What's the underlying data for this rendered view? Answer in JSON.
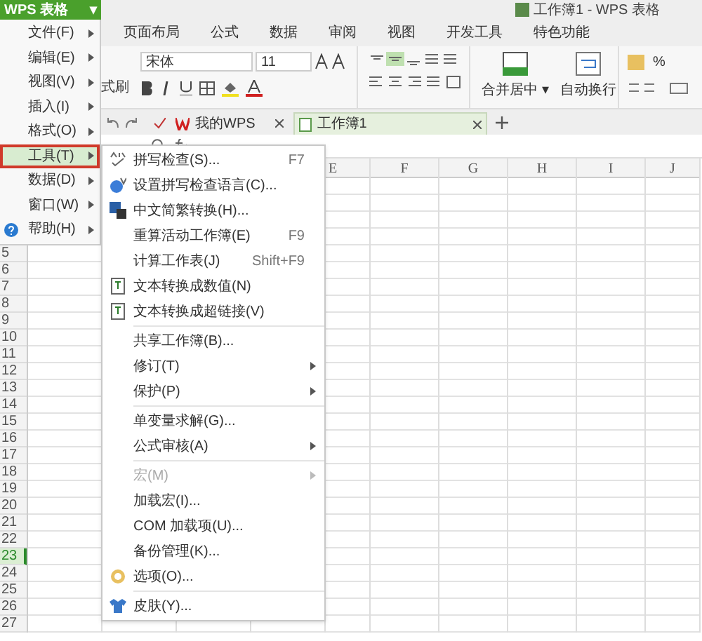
{
  "app_button": {
    "label": "WPS 表格",
    "caret": "▾"
  },
  "window": {
    "title": "工作簿1 - WPS 表格"
  },
  "ribbon_tabs": [
    {
      "label": "页面布局",
      "selected": false
    },
    {
      "label": "公式",
      "selected": false
    },
    {
      "label": "数据",
      "selected": false
    },
    {
      "label": "审阅",
      "selected": false
    },
    {
      "label": "视图",
      "selected": false
    },
    {
      "label": "开发工具",
      "selected": false
    },
    {
      "label": "特色功能",
      "selected": false
    }
  ],
  "ribbon": {
    "format_painter": "式刷",
    "font": "宋体",
    "font_size": "11",
    "merge_center": "合并居中",
    "merge_caret": "▾",
    "wrap_text": "自动换行",
    "percent": "%"
  },
  "doc_tabs": [
    {
      "label": "我的WPS",
      "selected": false
    },
    {
      "label": "工作簿1",
      "selected": true
    }
  ],
  "columns": [
    "E",
    "F",
    "G",
    "H",
    "I",
    "J"
  ],
  "rows": [
    {
      "label": "5",
      "selected": false
    },
    {
      "label": "6",
      "selected": false
    },
    {
      "label": "7",
      "selected": false
    },
    {
      "label": "8",
      "selected": false
    },
    {
      "label": "9",
      "selected": false
    },
    {
      "label": "10",
      "selected": false
    },
    {
      "label": "11",
      "selected": false
    },
    {
      "label": "12",
      "selected": false
    },
    {
      "label": "13",
      "selected": false
    },
    {
      "label": "14",
      "selected": false
    },
    {
      "label": "15",
      "selected": false
    },
    {
      "label": "16",
      "selected": false
    },
    {
      "label": "17",
      "selected": false
    },
    {
      "label": "18",
      "selected": false
    },
    {
      "label": "19",
      "selected": false
    },
    {
      "label": "20",
      "selected": false
    },
    {
      "label": "21",
      "selected": false
    },
    {
      "label": "22",
      "selected": false
    },
    {
      "label": "23",
      "selected": true
    },
    {
      "label": "24",
      "selected": false
    },
    {
      "label": "25",
      "selected": false
    },
    {
      "label": "26",
      "selected": false
    },
    {
      "label": "27",
      "selected": false
    }
  ],
  "main_menu": [
    {
      "label": "文件(F)",
      "selected": false
    },
    {
      "label": "编辑(E)",
      "selected": false
    },
    {
      "label": "视图(V)",
      "selected": false
    },
    {
      "label": "插入(I)",
      "selected": false
    },
    {
      "label": "格式(O)",
      "selected": false
    },
    {
      "label": "工具(T)",
      "selected": true
    },
    {
      "label": "数据(D)",
      "selected": false
    },
    {
      "label": "窗口(W)",
      "selected": false
    },
    {
      "label": "帮助(H)",
      "selected": false
    }
  ],
  "submenu": [
    {
      "kind": "item",
      "label": "拼写检查(S)...",
      "shortcut": "F7",
      "has_submenu": false,
      "disabled": false
    },
    {
      "kind": "item",
      "label": "设置拼写检查语言(C)...",
      "has_submenu": false,
      "disabled": false
    },
    {
      "kind": "item",
      "label": "中文简繁转换(H)...",
      "has_submenu": false,
      "disabled": false
    },
    {
      "kind": "item",
      "label": "重算活动工作簿(E)",
      "shortcut": "F9",
      "has_submenu": false,
      "disabled": false
    },
    {
      "kind": "item",
      "label": "计算工作表(J)",
      "shortcut": "Shift+F9",
      "has_submenu": false,
      "disabled": false
    },
    {
      "kind": "item",
      "label": "文本转换成数值(N)",
      "has_submenu": false,
      "disabled": false
    },
    {
      "kind": "item",
      "label": "文本转换成超链接(V)",
      "has_submenu": false,
      "disabled": false
    },
    {
      "kind": "separator"
    },
    {
      "kind": "item",
      "label": "共享工作簿(B)...",
      "has_submenu": false,
      "disabled": false
    },
    {
      "kind": "item",
      "label": "修订(T)",
      "has_submenu": true,
      "disabled": false
    },
    {
      "kind": "item",
      "label": "保护(P)",
      "has_submenu": true,
      "disabled": false
    },
    {
      "kind": "separator"
    },
    {
      "kind": "item",
      "label": "单变量求解(G)...",
      "has_submenu": false,
      "disabled": false
    },
    {
      "kind": "item",
      "label": "公式审核(A)",
      "has_submenu": true,
      "disabled": false
    },
    {
      "kind": "separator"
    },
    {
      "kind": "item",
      "label": "宏(M)",
      "has_submenu": true,
      "disabled": true
    },
    {
      "kind": "item",
      "label": "加载宏(I)...",
      "has_submenu": false,
      "disabled": false
    },
    {
      "kind": "item",
      "label": "COM 加载项(U)...",
      "has_submenu": false,
      "disabled": false
    },
    {
      "kind": "item",
      "label": "备份管理(K)...",
      "has_submenu": false,
      "disabled": false
    },
    {
      "kind": "item",
      "label": "选项(O)...",
      "has_submenu": false,
      "disabled": false
    },
    {
      "kind": "separator"
    },
    {
      "kind": "item",
      "label": "皮肤(Y)...",
      "has_submenu": false,
      "disabled": false
    }
  ]
}
